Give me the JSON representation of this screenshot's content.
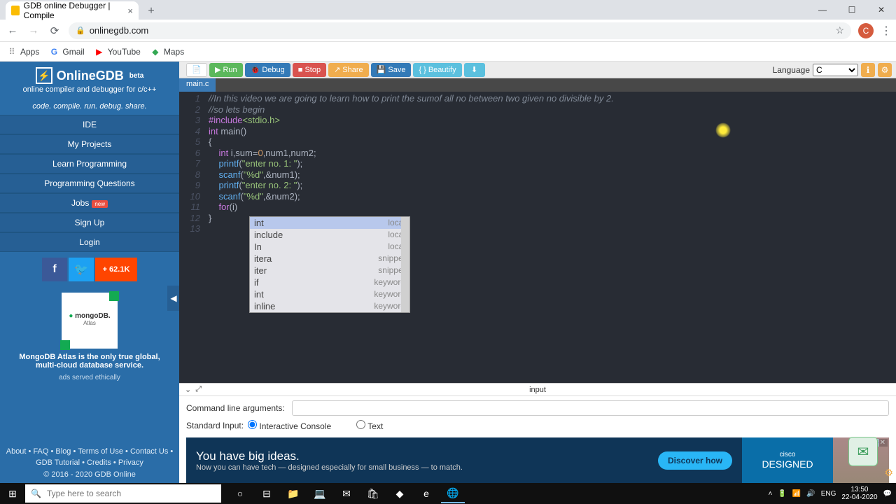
{
  "browser": {
    "tab_title": "GDB online Debugger | Compile",
    "url": "onlinegdb.com",
    "bookmarks": [
      "Apps",
      "Gmail",
      "YouTube",
      "Maps"
    ]
  },
  "sidebar": {
    "logo": "OnlineGDB",
    "beta": "beta",
    "subtitle": "online compiler and debugger for c/c++",
    "tagline": "code. compile. run. debug. share.",
    "items": [
      "IDE",
      "My Projects",
      "Learn Programming",
      "Programming Questions",
      "Jobs",
      "Sign Up",
      "Login"
    ],
    "jobs_badge": "new",
    "share_count": "62.1K",
    "mongo_name": "mongoDB.",
    "mongo_sub": "Atlas",
    "ad_tagline": "MongoDB Atlas is the only true global, multi-cloud database service.",
    "ad_eth": "ads served ethically",
    "footer1": "About • FAQ • Blog • Terms of Use • Contact Us • GDB Tutorial • Credits • Privacy",
    "copyright": "© 2016 - 2020 GDB Online"
  },
  "toolbar": {
    "run": "Run",
    "debug": "Debug",
    "stop": "Stop",
    "share": "Share",
    "save": "Save",
    "beautify": "Beautify",
    "lang_label": "Language",
    "lang_value": "C"
  },
  "file_tab": "main.c",
  "code": {
    "lines": [
      1,
      2,
      3,
      4,
      5,
      6,
      7,
      8,
      9,
      10,
      11,
      12,
      13
    ],
    "l1": "//In this video we are going to learn how to print the sumof all no between two given no divisible by 2.",
    "l2": "//so lets begin",
    "l3a": "#include",
    "l3b": "<stdio.h>",
    "l4a": "int",
    "l4b": " main()",
    "l5": "{",
    "l6a": "int",
    "l6b": " i,sum=",
    "l6c": "0",
    "l6d": ",num1,num2;",
    "l7a": "printf",
    "l7b": "(",
    "l7c": "\"enter no. 1: \"",
    "l7d": ");",
    "l8a": "scanf",
    "l8b": "(",
    "l8c": "\"%d\"",
    "l8d": ",&num1);",
    "l9a": "printf",
    "l9b": "(",
    "l9c": "\"enter no. 2: \"",
    "l9d": ");",
    "l10a": "scanf",
    "l10b": "(",
    "l10c": "\"%d\"",
    "l10d": ",&num2);",
    "l11a": "for",
    "l11b": "(i)",
    "l12": "}"
  },
  "autocomplete": [
    {
      "k": "int",
      "t": "local"
    },
    {
      "k": "include",
      "t": "local"
    },
    {
      "k": "In",
      "t": "local"
    },
    {
      "k": "itera",
      "t": "snippet"
    },
    {
      "k": "iter",
      "t": "snippet"
    },
    {
      "k": "if",
      "t": "keyword"
    },
    {
      "k": "int",
      "t": "keyword"
    },
    {
      "k": "inline",
      "t": "keyword"
    }
  ],
  "bottom": {
    "input_title": "input",
    "cli_label": "Command line arguments:",
    "stdin_label": "Standard Input:",
    "opt1": "Interactive Console",
    "opt2": "Text"
  },
  "ad": {
    "headline": "You have big ideas.",
    "sub": "Now you can have tech — designed especially for small business — to match.",
    "cta": "Discover how",
    "brand1": "cisco",
    "brand2": "DESIGNED"
  },
  "taskbar": {
    "search_ph": "Type here to search",
    "lang": "ENG",
    "time": "13:50",
    "date": "22-04-2020"
  }
}
